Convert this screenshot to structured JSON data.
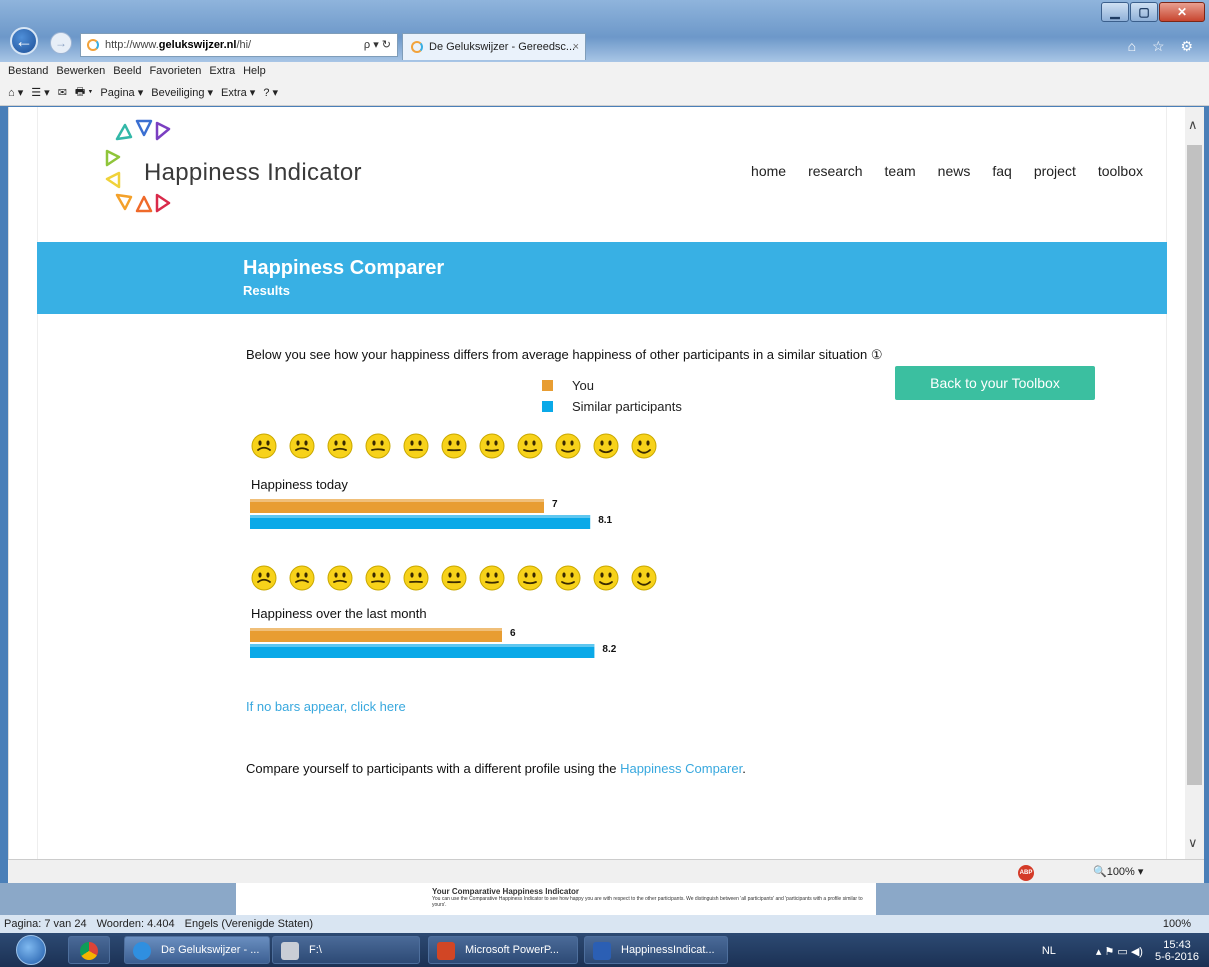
{
  "browser": {
    "url_prefix": "http://www.",
    "url_domain": "gelukswijzer.nl",
    "url_path": "/hi/",
    "addr_tools": "ρ ▾ ↻",
    "tab_title": "De Gelukswijzer - Gereedsc...",
    "tab_close": "×",
    "icons": "⌂ ☆ ⚙",
    "menu": [
      "Bestand",
      "Bewerken",
      "Beeld",
      "Favorieten",
      "Extra",
      "Help"
    ],
    "commands": [
      "⌂ ▾",
      "☰ ▾",
      "✉",
      "🖶 ▾",
      "Pagina ▾",
      "Beveiliging ▾",
      "Extra ▾",
      "? ▾"
    ],
    "abp_label": "ABP",
    "zoom": "🔍100% ▾"
  },
  "site": {
    "logo_text": "Happiness Indicator",
    "nav": [
      "home",
      "research",
      "team",
      "news",
      "faq",
      "project",
      "toolbox"
    ]
  },
  "banner": {
    "title": "Happiness Comparer",
    "subtitle": "Results"
  },
  "intro_text": "Below you see how your happiness differs from average happiness of other participants in a similar situation ①",
  "legend": {
    "you": "You",
    "similar": "Similar participants"
  },
  "back_button": "Back to your Toolbox",
  "colors": {
    "you": "#e89d32",
    "similar": "#0aa9e8",
    "accent": "#38b0e4",
    "button": "#3bbfa0"
  },
  "chart_data": {
    "type": "bar",
    "orientation": "horizontal",
    "xlim": [
      0,
      10
    ],
    "series_names": [
      "You",
      "Similar participants"
    ],
    "groups": [
      {
        "label": "Happiness today",
        "you": 7,
        "similar": 8.1
      },
      {
        "label": "Happiness over the last month",
        "you": 6,
        "similar": 8.2
      }
    ]
  },
  "no_bars_link": "If no bars appear, click here",
  "compare": {
    "prefix": "Compare yourself to participants with a different profile using the ",
    "link": "Happiness Comparer",
    "suffix": "."
  },
  "word": {
    "doc_heading": "Your Comparative Happiness Indicator",
    "doc_body": "You can use the Comparative Happiness Indicator to see how happy you are with respect to the other participants. We distinguish between 'all participants' and 'participants with a profile similar to yours'.",
    "page": "Pagina: 7 van 24",
    "words": "Woorden: 4.404",
    "language": "Engels (Verenigde Staten)",
    "zoom": "100%"
  },
  "taskbar": {
    "items": [
      "De Gelukswijzer - ...",
      "F:\\",
      "Microsoft PowerP...",
      "HappinessIndicat..."
    ],
    "lang": "NL",
    "time": "15:43",
    "date": "5-6-2016"
  }
}
